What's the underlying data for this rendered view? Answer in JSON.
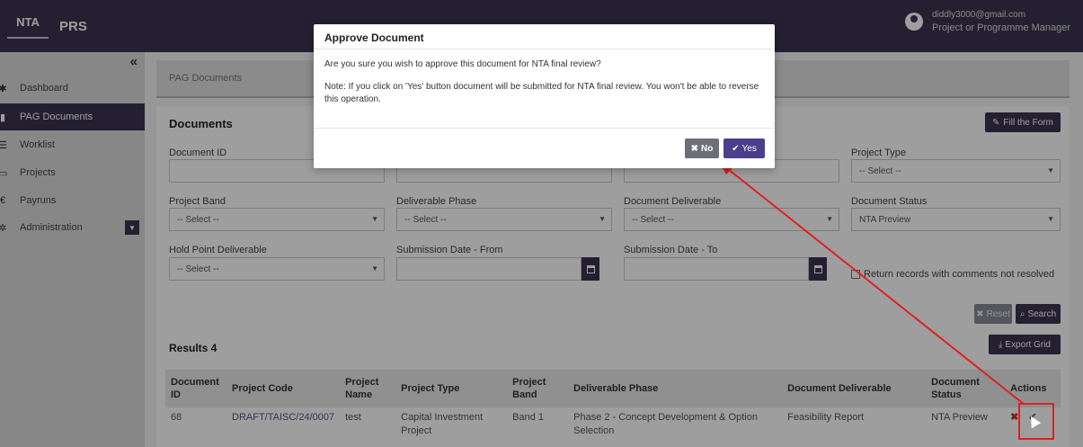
{
  "topbar": {
    "logo_text": "NTA",
    "app_name": "PRS",
    "user_email": "diddly3000@gmail.com",
    "user_role": "Project or Programme Manager"
  },
  "sidebar": {
    "collapse_icon": "«",
    "items": [
      {
        "label": "Dashboard",
        "icon": "gauge-icon"
      },
      {
        "label": "PAG Documents",
        "icon": "document-icon"
      },
      {
        "label": "Worklist",
        "icon": "list-icon"
      },
      {
        "label": "Projects",
        "icon": "folder-icon"
      },
      {
        "label": "Payruns",
        "icon": "euro-icon"
      },
      {
        "label": "Administration",
        "icon": "gear-icon"
      }
    ]
  },
  "breadcrumb": "PAG Documents",
  "documents": {
    "title": "Documents",
    "fill_form_label": "Fill the Form",
    "filters": {
      "document_id": {
        "label": "Document ID",
        "value": ""
      },
      "project_type": {
        "label": "Project Type",
        "value": "-- Select --"
      },
      "project_band": {
        "label": "Project Band",
        "value": "-- Select --"
      },
      "deliverable_phase": {
        "label": "Deliverable Phase",
        "value": "-- Select --"
      },
      "document_deliverable": {
        "label": "Document Deliverable",
        "value": "-- Select --"
      },
      "document_status": {
        "label": "Document Status",
        "value": "NTA Preview"
      },
      "hold_point": {
        "label": "Hold Point Deliverable",
        "value": "-- Select --"
      },
      "submission_from": {
        "label": "Submission Date - From",
        "value": ""
      },
      "submission_to": {
        "label": "Submission Date - To",
        "value": ""
      },
      "comments_checkbox": "Return records with comments not resolved"
    },
    "reset_label": "Reset",
    "search_label": "Search",
    "export_label": "Export Grid"
  },
  "results": {
    "title": "Results 4",
    "columns": [
      "Document ID",
      "Project Code",
      "Project Name",
      "Project Type",
      "Project Band",
      "Deliverable Phase",
      "Document Deliverable",
      "Document Status",
      "Actions"
    ],
    "rows": [
      [
        "68",
        "DRAFT/TAISC/24/0007",
        "test",
        "Capital Investment Project",
        "Band 1",
        "Phase 2 - Concept Development & Option Selection",
        "Feasibility Report",
        "NTA Preview"
      ]
    ]
  },
  "modal": {
    "title": "Approve Document",
    "question": "Are you sure you wish to approve this document for NTA final review?",
    "note": "Note: If you click on 'Yes' button document will be submitted for NTA final review. You won't be able to reverse this operation.",
    "no_label": "No",
    "yes_label": "Yes"
  },
  "colors": {
    "brand": "#3a3550",
    "annotation": "#e02020"
  }
}
